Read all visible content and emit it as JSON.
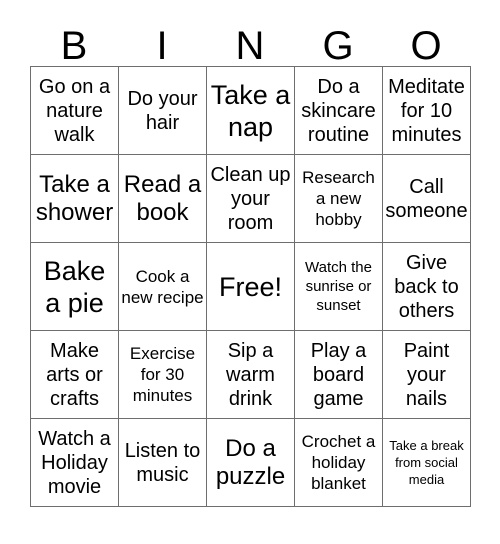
{
  "card": {
    "header_letters": [
      "B",
      "I",
      "N",
      "G",
      "O"
    ],
    "rows": [
      [
        {
          "text": "Go on a nature walk",
          "size": "md"
        },
        {
          "text": "Do your hair",
          "size": "md"
        },
        {
          "text": "Take a nap",
          "size": "xl"
        },
        {
          "text": "Do a skincare routine",
          "size": "md"
        },
        {
          "text": "Meditate for 10 minutes",
          "size": "md"
        }
      ],
      [
        {
          "text": "Take a shower",
          "size": "lg"
        },
        {
          "text": "Read a book",
          "size": "lg"
        },
        {
          "text": "Clean up your room",
          "size": "md"
        },
        {
          "text": "Research a new hobby",
          "size": "sm"
        },
        {
          "text": "Call someone",
          "size": "md"
        }
      ],
      [
        {
          "text": "Bake a pie",
          "size": "xl"
        },
        {
          "text": "Cook a new recipe",
          "size": "sm"
        },
        {
          "text": "Free!",
          "size": "xl"
        },
        {
          "text": "Watch the sunrise or sunset",
          "size": "xs"
        },
        {
          "text": "Give back to others",
          "size": "md"
        }
      ],
      [
        {
          "text": "Make arts or crafts",
          "size": "md"
        },
        {
          "text": "Exercise for 30 minutes",
          "size": "sm"
        },
        {
          "text": "Sip a warm drink",
          "size": "md"
        },
        {
          "text": "Play a board game",
          "size": "md"
        },
        {
          "text": "Paint your nails",
          "size": "md"
        }
      ],
      [
        {
          "text": "Watch a Holiday movie",
          "size": "md"
        },
        {
          "text": "Listen to music",
          "size": "md"
        },
        {
          "text": "Do a puzzle",
          "size": "lg"
        },
        {
          "text": "Crochet a holiday blanket",
          "size": "sm"
        },
        {
          "text": "Take a break from social media",
          "size": "xxs"
        }
      ]
    ],
    "colors": {
      "background": "#ffffff",
      "text": "#000000",
      "grid_line": "#6e6e6e"
    }
  }
}
